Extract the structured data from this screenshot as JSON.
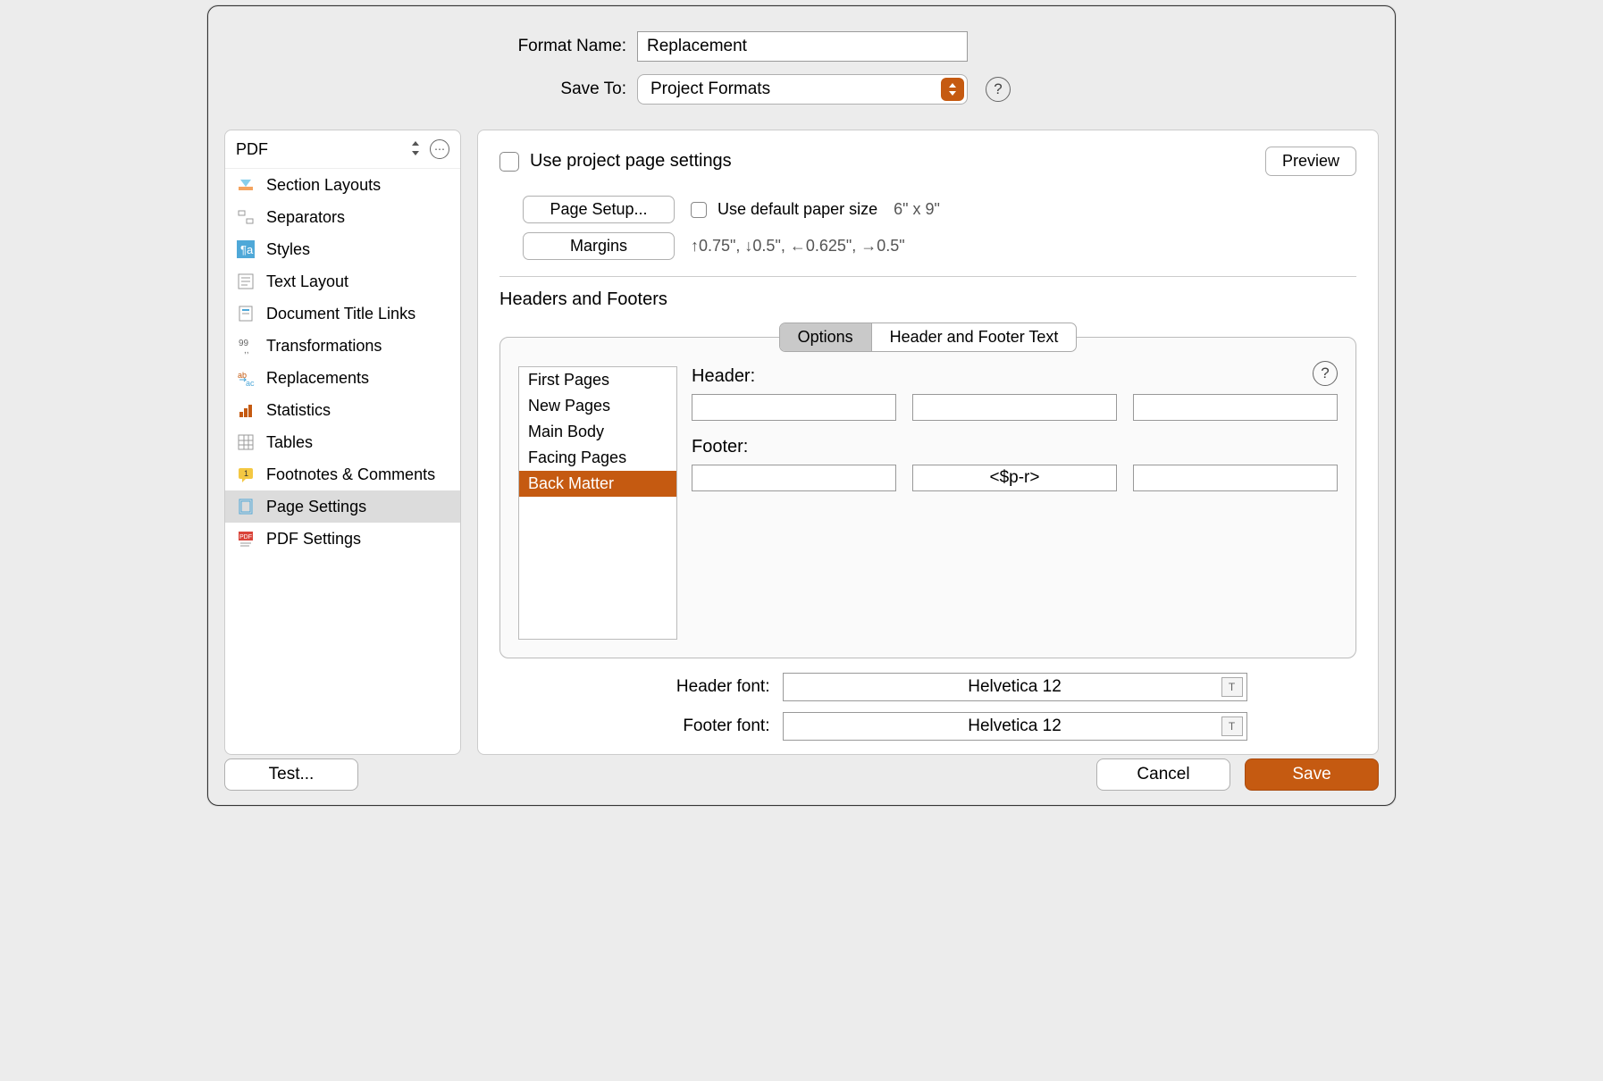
{
  "form": {
    "formatNameLabel": "Format Name:",
    "formatNameValue": "Replacement",
    "saveToLabel": "Save To:",
    "saveToValue": "Project Formats"
  },
  "sidebar": {
    "header": "PDF",
    "items": [
      {
        "label": "Section Layouts"
      },
      {
        "label": "Separators"
      },
      {
        "label": "Styles"
      },
      {
        "label": "Text Layout"
      },
      {
        "label": "Document Title Links"
      },
      {
        "label": "Transformations"
      },
      {
        "label": "Replacements"
      },
      {
        "label": "Statistics"
      },
      {
        "label": "Tables"
      },
      {
        "label": "Footnotes & Comments"
      },
      {
        "label": "Page Settings"
      },
      {
        "label": "PDF Settings"
      }
    ],
    "selectedIndex": 10
  },
  "main": {
    "useProjectPageSettings": "Use project page settings",
    "previewBtn": "Preview",
    "pageSetupBtn": "Page Setup...",
    "useDefaultPaper": "Use default paper size",
    "paperSize": "6\" x 9\"",
    "marginsBtn": "Margins",
    "marginsText": "↑0.75\", ↓0.5\", ←0.625\", →0.5\"",
    "headersFootersTitle": "Headers and Footers",
    "tabs": {
      "options": "Options",
      "hfText": "Header and Footer Text"
    },
    "hfList": [
      {
        "label": "First Pages"
      },
      {
        "label": "New Pages"
      },
      {
        "label": "Main Body"
      },
      {
        "label": "Facing Pages"
      },
      {
        "label": "Back Matter"
      }
    ],
    "hfSelectedIndex": 4,
    "headerLabel": "Header:",
    "footerLabel": "Footer:",
    "headerCells": [
      "",
      "",
      ""
    ],
    "footerCells": [
      "",
      "<$p-r>",
      ""
    ],
    "headerFontLabel": "Header font:",
    "footerFontLabel": "Footer font:",
    "headerFontValue": "Helvetica 12",
    "footerFontValue": "Helvetica 12"
  },
  "bottom": {
    "test": "Test...",
    "cancel": "Cancel",
    "save": "Save"
  },
  "help": "?"
}
